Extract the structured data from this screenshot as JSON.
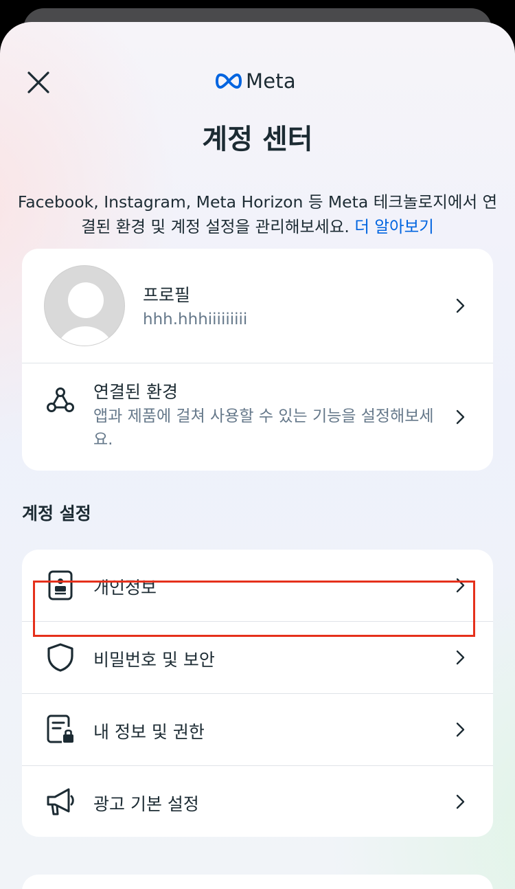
{
  "header": {
    "close_icon": "close-icon",
    "brand": "Meta",
    "brand_logo_color": "#0064e0"
  },
  "page": {
    "title": "계정 센터",
    "description": "Facebook, Instagram, Meta Horizon 등 Meta 테크놀로지에서 연결된 환경 및 계정 설정을 관리해보세요.",
    "learn_more": "더 알아보기"
  },
  "profile": {
    "label": "프로필",
    "username": "hhh.hhhiiiiiiiii"
  },
  "connected": {
    "title": "연결된 환경",
    "subtitle": "앱과 제품에 걸쳐 사용할 수 있는 기능을 설정해보세요.",
    "icon": "connected-experiences-icon"
  },
  "account_settings": {
    "title": "계정 설정",
    "items": [
      {
        "label": "개인정보",
        "icon": "id-card-icon"
      },
      {
        "label": "비밀번호 및 보안",
        "icon": "shield-icon"
      },
      {
        "label": "내 정보 및 권한",
        "icon": "document-lock-icon"
      },
      {
        "label": "광고 기본 설정",
        "icon": "megaphone-icon"
      }
    ]
  },
  "colors": {
    "text": "#1c2b33",
    "secondary_text": "#65788a",
    "link": "#0064e0",
    "highlight_border": "#e5301b"
  }
}
